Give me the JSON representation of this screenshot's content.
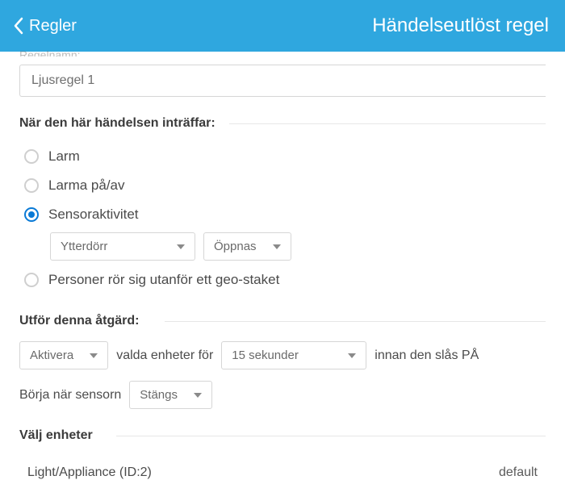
{
  "header": {
    "back_label": "Regler",
    "title": "Händelseutlöst regel"
  },
  "rule_name": {
    "label": "Regelnamn:",
    "value": "Ljusregel 1"
  },
  "when": {
    "section_label": "När den här händelsen inträffar:",
    "options": {
      "alarm": "Larm",
      "arm_disarm": "Larma på/av",
      "sensor_activity": "Sensoraktivitet",
      "geofence": "Personer rör sig utanför ett geo-staket"
    },
    "selected": "sensor_activity",
    "sensor_select": "Ytterdörr",
    "sensor_state": "Öppnas"
  },
  "action": {
    "section_label": "Utför denna åtgärd:",
    "verb": "Aktivera",
    "mid_text": "valda enheter för",
    "duration": "15 sekunder",
    "tail_text": "innan den slås PÅ",
    "start_label": "Börja när sensorn",
    "start_state": "Stängs"
  },
  "devices": {
    "section_label": "Välj enheter",
    "rows": [
      {
        "name": "Light/Appliance (ID:2)",
        "value": "default"
      }
    ]
  }
}
